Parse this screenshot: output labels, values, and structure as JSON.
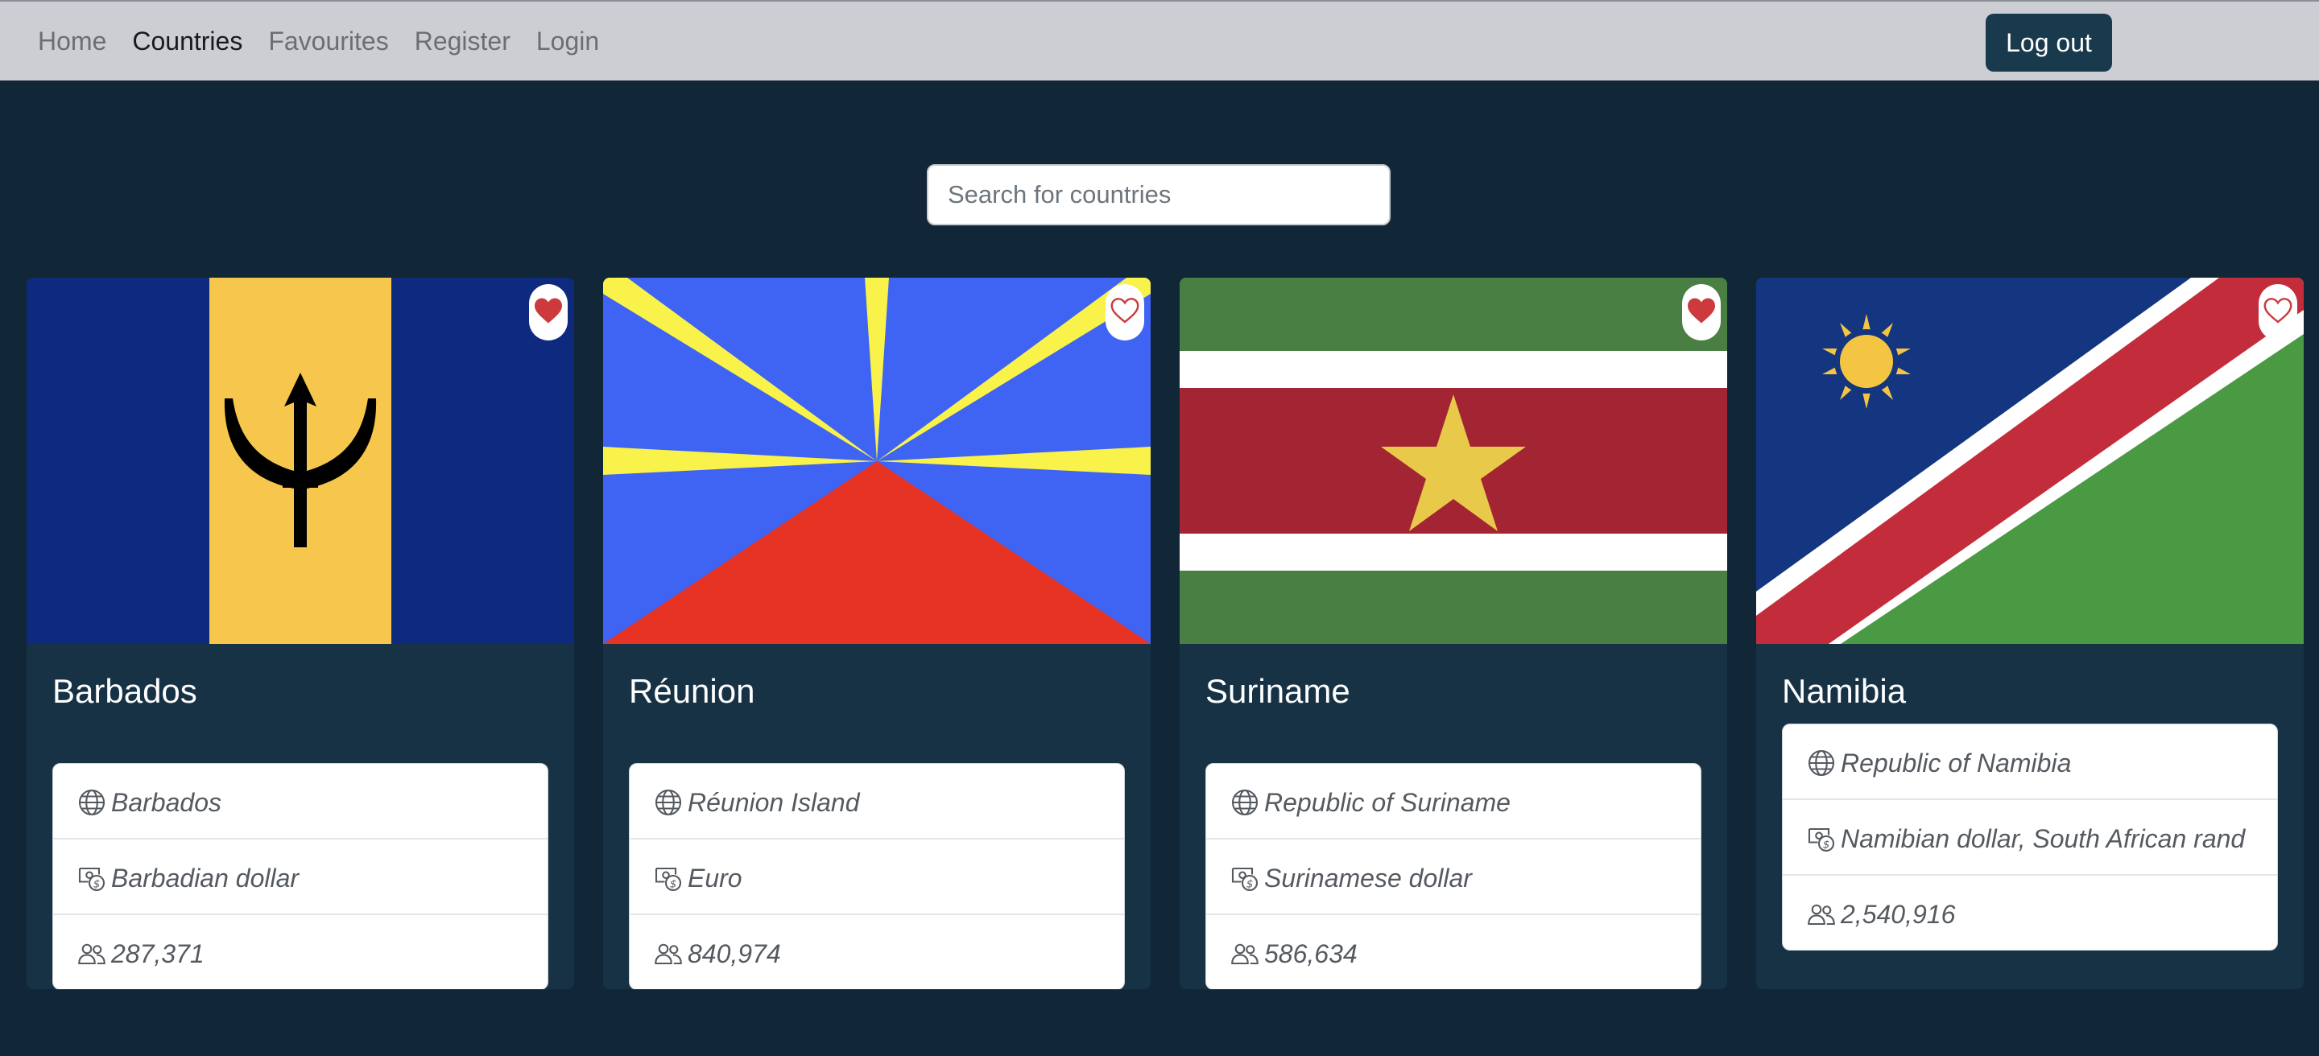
{
  "nav": {
    "items": [
      {
        "label": "Home",
        "active": false
      },
      {
        "label": "Countries",
        "active": true
      },
      {
        "label": "Favourites",
        "active": false
      },
      {
        "label": "Register",
        "active": false
      },
      {
        "label": "Login",
        "active": false
      }
    ],
    "logout_label": "Log out"
  },
  "search": {
    "placeholder": "Search for countries",
    "value": ""
  },
  "colors": {
    "page_bg": "#112636",
    "card_bg": "#163244",
    "navbar_bg": "#cdced3",
    "logout_bg": "#193a4d",
    "heart": "#cc3a3e"
  },
  "cards": [
    {
      "name": "Barbados",
      "official_name": "Barbados",
      "currency": "Barbadian dollar",
      "population": "287,371",
      "favourite": true
    },
    {
      "name": "Réunion",
      "official_name": "Réunion Island",
      "currency": "Euro",
      "population": "840,974",
      "favourite": false
    },
    {
      "name": "Suriname",
      "official_name": "Republic of Suriname",
      "currency": "Surinamese dollar",
      "population": "586,634",
      "favourite": true
    },
    {
      "name": "Namibia",
      "official_name": "Republic of Namibia",
      "currency": "Namibian dollar, South African rand",
      "population": "2,540,916",
      "favourite": true
    }
  ],
  "icons": {
    "official_name": "globe-icon",
    "currency": "cash-coin-icon",
    "population": "people-icon",
    "favourite": "heart-icon"
  }
}
